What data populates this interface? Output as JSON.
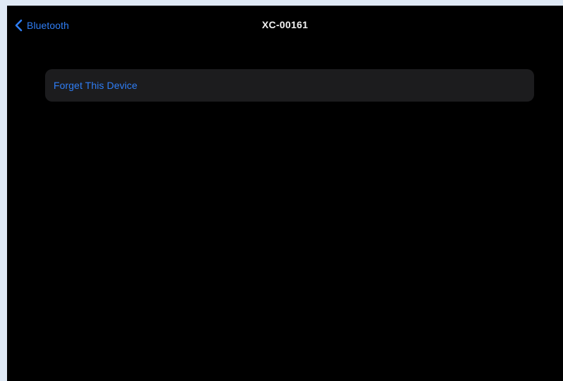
{
  "nav": {
    "back_label": "Bluetooth",
    "title": "XC-00161"
  },
  "actions": {
    "forget_device_label": "Forget This Device"
  },
  "colors": {
    "accent": "#2f7ef6",
    "background": "#000000",
    "cell_background": "#1c1c1e",
    "title_text": "#f2f2f2"
  },
  "icons": {
    "back": "chevron-left-icon"
  }
}
